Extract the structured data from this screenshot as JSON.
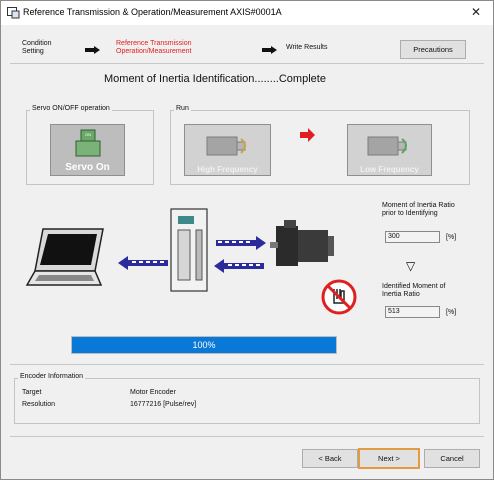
{
  "window": {
    "title": "Reference Transmission & Operation/Measurement AXIS#0001A",
    "close_glyph": "✕"
  },
  "steps": {
    "step1": "Condition\nSetting",
    "step2": "Reference Transmission\nOperation/Measurement",
    "step3": "Write Results",
    "precautions": "Precautions"
  },
  "status": {
    "text": "Moment of Inertia Identification........Complete"
  },
  "servo_group": {
    "label": "Servo ON/OFF operation",
    "button": "Servo On",
    "button_top": "ON"
  },
  "run_group": {
    "label": "Run",
    "high": "High Frequency",
    "low": "Low Frequency"
  },
  "ratio": {
    "before_label": "Moment of Inertia Ratio\nprior to Identifying",
    "before_value": "300",
    "before_unit": "[%]",
    "arrow": "▽",
    "after_label": "Identified Moment of\nInertia Ratio",
    "after_value": "513",
    "after_unit": "[%]"
  },
  "progress": {
    "value": 1.0,
    "label": "100%"
  },
  "encoder": {
    "section": "Encoder Information",
    "target_label": "Target",
    "target_value": "Motor Encoder",
    "resolution_label": "Resolution",
    "resolution_value": "16777216 [Pulse/rev]"
  },
  "footer": {
    "back": "< Back",
    "next": "Next >",
    "cancel": "Cancel"
  },
  "colors": {
    "accent_red": "#e02020",
    "progress_blue": "#0a78d7",
    "arrow_blue": "#2b2b9c"
  }
}
